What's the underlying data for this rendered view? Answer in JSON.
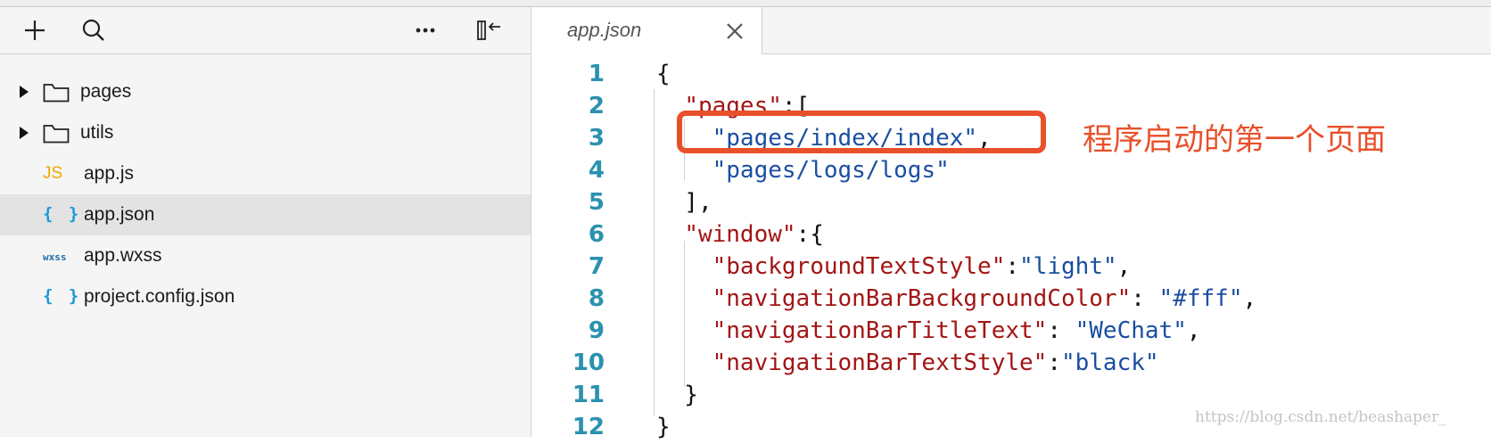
{
  "toolbar": {
    "add_icon": "plus-icon",
    "search_icon": "search-icon",
    "more_icon": "ellipsis-icon",
    "collapse_icon": "collapse-sidebar-icon"
  },
  "sidebar": {
    "items": [
      {
        "type": "folder",
        "label": "pages"
      },
      {
        "type": "folder",
        "label": "utils"
      },
      {
        "type": "js",
        "icon_text": "JS",
        "label": "app.js"
      },
      {
        "type": "json",
        "icon_text": "{ }",
        "label": "app.json",
        "selected": true
      },
      {
        "type": "wxss",
        "icon_text": "wxss",
        "label": "app.wxss"
      },
      {
        "type": "json",
        "icon_text": "{ }",
        "label": "project.config.json"
      }
    ]
  },
  "editor": {
    "tab": {
      "label": "app.json"
    },
    "lines": [
      {
        "num": "1",
        "text": "{"
      },
      {
        "num": "2",
        "text": "  \"pages\":["
      },
      {
        "num": "3",
        "text": "    \"pages/index/index\","
      },
      {
        "num": "4",
        "text": "    \"pages/logs/logs\""
      },
      {
        "num": "5",
        "text": "  ],"
      },
      {
        "num": "6",
        "text": "  \"window\":{"
      },
      {
        "num": "7",
        "text": "    \"backgroundTextStyle\":\"light\","
      },
      {
        "num": "8",
        "text": "    \"navigationBarBackgroundColor\": \"#fff\","
      },
      {
        "num": "9",
        "text": "    \"navigationBarTitleText\": \"WeChat\","
      },
      {
        "num": "10",
        "text": "    \"navigationBarTextStyle\":\"black\""
      },
      {
        "num": "11",
        "text": "  }"
      },
      {
        "num": "12",
        "text": "}"
      }
    ]
  },
  "annotation": {
    "text": "程序启动的第一个页面"
  },
  "watermark": {
    "text": "https://blog.csdn.net/beashaper_"
  },
  "colors": {
    "accent": "#e8502a",
    "line_number": "#2b91af",
    "json_key": "#a31515",
    "json_value": "#1a4fa0",
    "js_icon": "#f0a800",
    "json_icon": "#1a9ad6"
  }
}
